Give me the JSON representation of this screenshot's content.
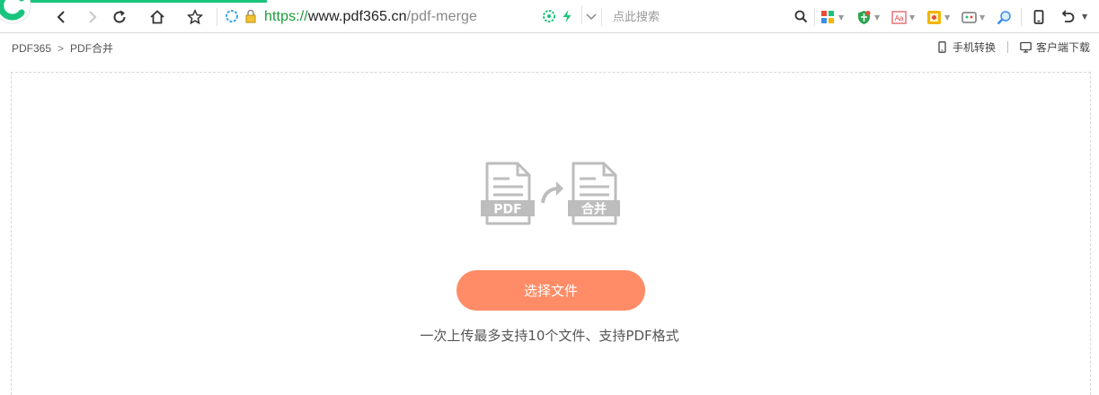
{
  "browser": {
    "url_scheme": "https://",
    "url_host": "www.pdf365.cn",
    "url_path": "/pdf-merge",
    "search_placeholder": "点此搜索",
    "accent_color": "#1bc47d"
  },
  "header": {
    "breadcrumb_home": "PDF365",
    "breadcrumb_separator": ">",
    "breadcrumb_current": "PDF合并",
    "mobile_link": "手机转换",
    "download_link": "客户端下载"
  },
  "upload": {
    "illustration_source_label": "PDF",
    "illustration_result_label": "合并",
    "select_button": "选择文件",
    "hint": "一次上传最多支持10个文件、支持PDF格式",
    "button_color": "#ff8c66"
  }
}
